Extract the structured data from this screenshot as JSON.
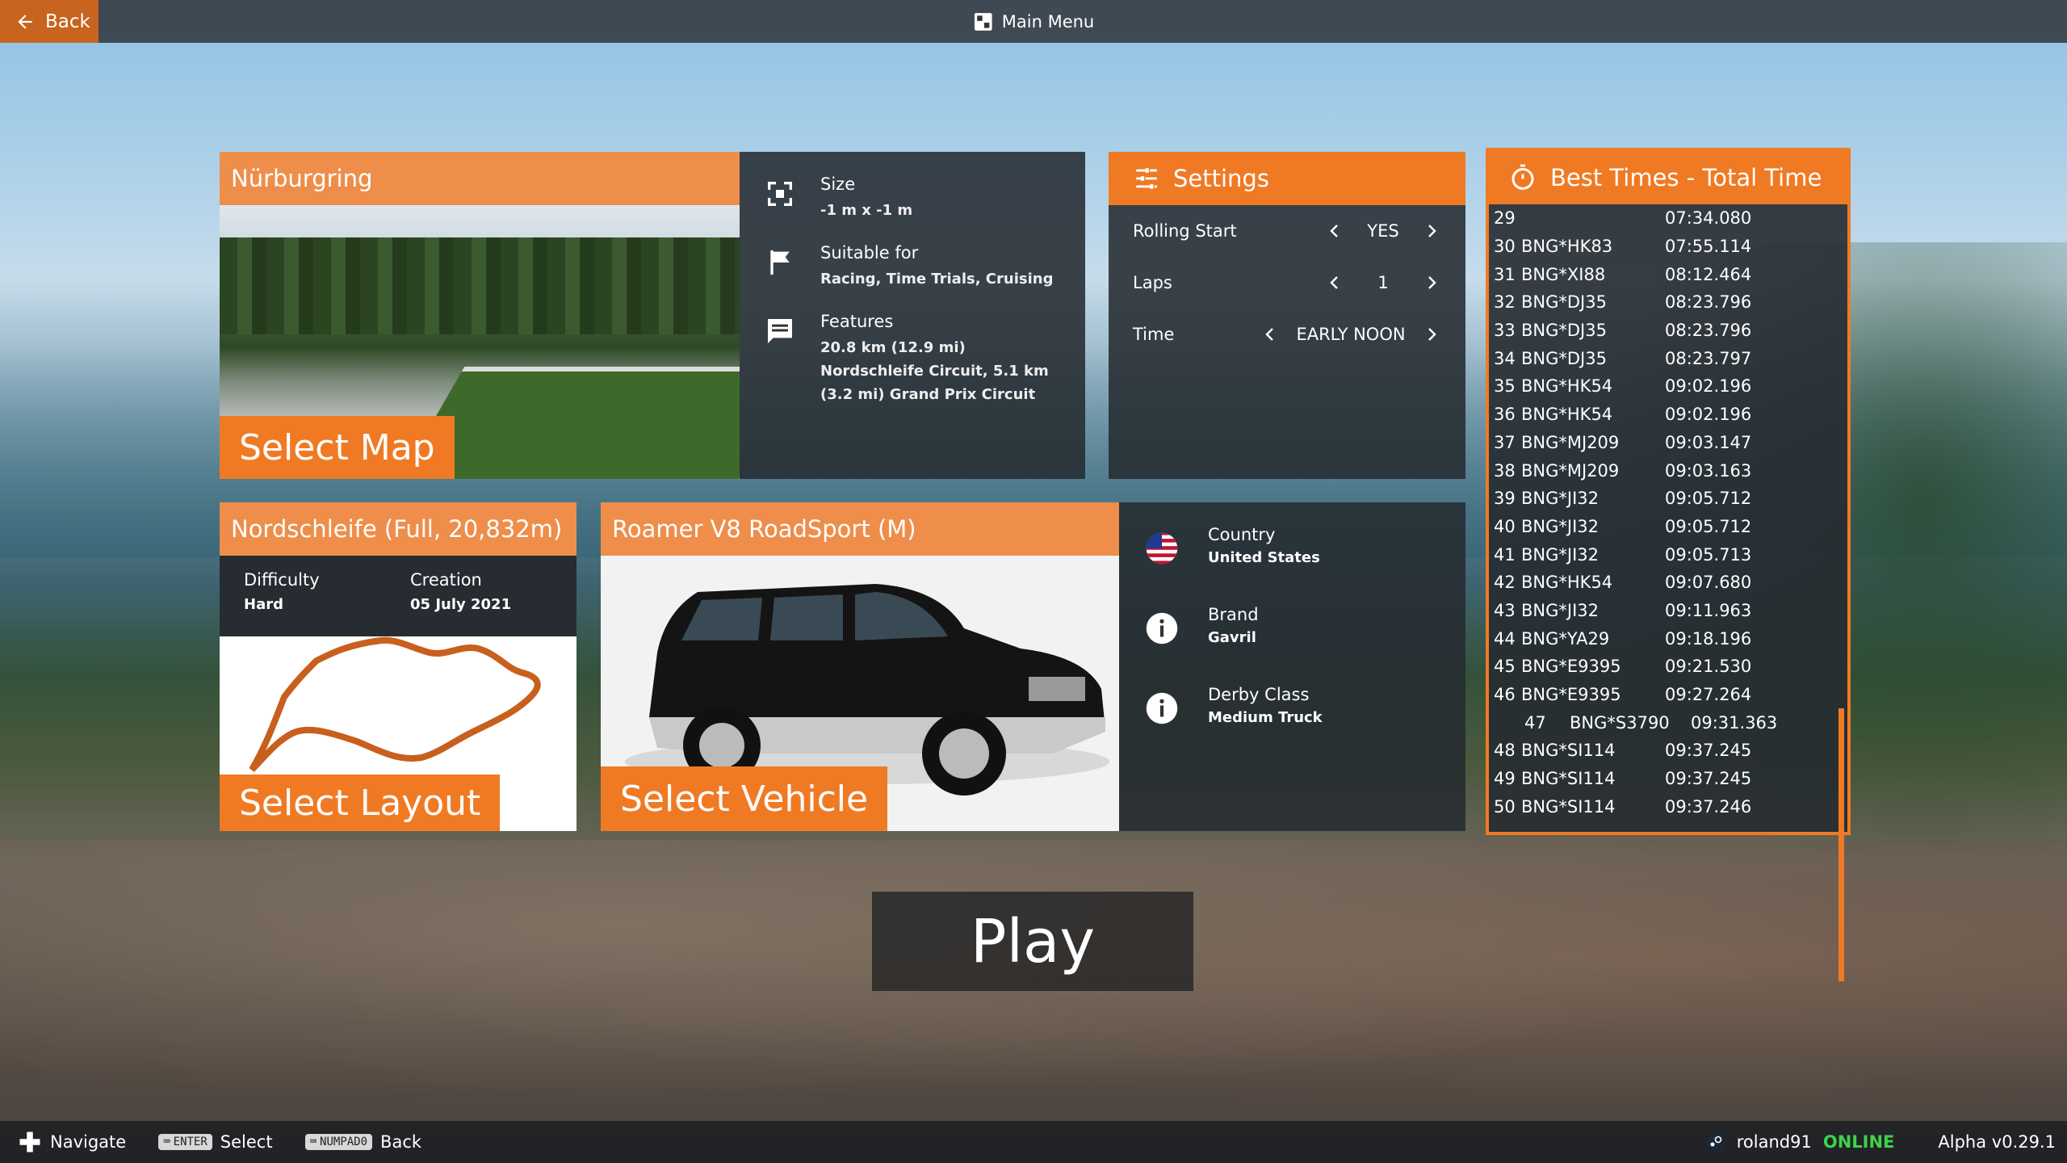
{
  "topbar": {
    "back_label": "Back",
    "title": "Main Menu"
  },
  "map": {
    "name": "Nürburgring",
    "select_label": "Select Map",
    "info": [
      {
        "icon": "size-icon",
        "title": "Size",
        "value": "-1 m x -1 m"
      },
      {
        "icon": "flag-icon",
        "title": "Suitable for",
        "value": "Racing, Time Trials, Cruising"
      },
      {
        "icon": "chat-icon",
        "title": "Features",
        "value": "20.8 km (12.9 mi) Nordschleife Circuit, 5.1 km (3.2 mi) Grand Prix Circuit"
      }
    ]
  },
  "settings": {
    "title": "Settings",
    "rows": [
      {
        "label": "Rolling Start",
        "value": "YES"
      },
      {
        "label": "Laps",
        "value": "1"
      },
      {
        "label": "Time",
        "value": "EARLY NOON"
      }
    ]
  },
  "best_times": {
    "title": "Best Times - Total Time",
    "rows": [
      {
        "rank": "29",
        "name": "",
        "time": "07:34.080"
      },
      {
        "rank": "30",
        "name": "BNG*HK83",
        "time": "07:55.114"
      },
      {
        "rank": "31",
        "name": "BNG*XI88",
        "time": "08:12.464"
      },
      {
        "rank": "32",
        "name": "BNG*DJ35",
        "time": "08:23.796"
      },
      {
        "rank": "33",
        "name": "BNG*DJ35",
        "time": "08:23.796"
      },
      {
        "rank": "34",
        "name": "BNG*DJ35",
        "time": "08:23.797"
      },
      {
        "rank": "35",
        "name": "BNG*HK54",
        "time": "09:02.196"
      },
      {
        "rank": "36",
        "name": "BNG*HK54",
        "time": "09:02.196"
      },
      {
        "rank": "37",
        "name": "BNG*MJ209",
        "time": "09:03.147"
      },
      {
        "rank": "38",
        "name": "BNG*MJ209",
        "time": "09:03.163"
      },
      {
        "rank": "39",
        "name": "BNG*JI32",
        "time": "09:05.712"
      },
      {
        "rank": "40",
        "name": "BNG*JI32",
        "time": "09:05.712"
      },
      {
        "rank": "41",
        "name": "BNG*JI32",
        "time": "09:05.713"
      },
      {
        "rank": "42",
        "name": "BNG*HK54",
        "time": "09:07.680"
      },
      {
        "rank": "43",
        "name": "BNG*JI32",
        "time": "09:11.963"
      },
      {
        "rank": "44",
        "name": "BNG*YA29",
        "time": "09:18.196"
      },
      {
        "rank": "45",
        "name": "BNG*E9395",
        "time": "09:21.530"
      },
      {
        "rank": "46",
        "name": "BNG*E9395",
        "time": "09:27.264"
      },
      {
        "rank": "47",
        "name": "BNG*S3790",
        "time": "09:31.363",
        "self": true
      },
      {
        "rank": "48",
        "name": "BNG*SI114",
        "time": "09:37.245"
      },
      {
        "rank": "49",
        "name": "BNG*SI114",
        "time": "09:37.245"
      },
      {
        "rank": "50",
        "name": "BNG*SI114",
        "time": "09:37.246"
      }
    ]
  },
  "layout": {
    "name": "Nordschleife (Full, 20,832m)",
    "difficulty_label": "Difficulty",
    "difficulty_value": "Hard",
    "creation_label": "Creation",
    "creation_value": "05 July 2021",
    "select_label": "Select Layout"
  },
  "vehicle": {
    "name": "Roamer V8 RoadSport (M)",
    "select_label": "Select Vehicle",
    "info": [
      {
        "icon": "us-flag-icon",
        "title": "Country",
        "value": "United States"
      },
      {
        "icon": "info-icon",
        "title": "Brand",
        "value": "Gavril"
      },
      {
        "icon": "info-icon",
        "title": "Derby Class",
        "value": "Medium Truck"
      }
    ]
  },
  "play_label": "Play",
  "bottombar": {
    "navigate": "Navigate",
    "enter_key": "ENTER",
    "select": "Select",
    "numpad_key": "NUMPAD0",
    "back": "Back",
    "username": "roland91",
    "status": "ONLINE",
    "version": "Alpha v0.29.1"
  },
  "colors": {
    "accent": "#f07a24",
    "header": "#ee8e4a",
    "online": "#3fd24a"
  }
}
